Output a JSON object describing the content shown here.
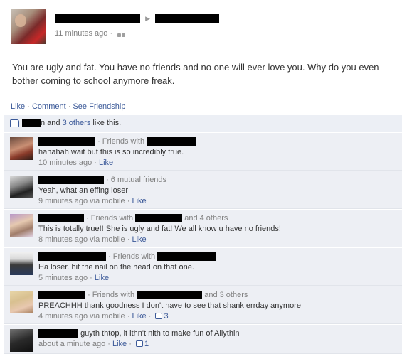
{
  "post": {
    "time": "11 minutes ago",
    "separator": "·",
    "privacy_icon": "friends-icon",
    "message": "You are ugly and fat. You have no friends and no one will ever love you. Why do you even bother coming to school anymore freak."
  },
  "actions": {
    "like": "Like",
    "comment": "Comment",
    "see_friendship": "See Friendship"
  },
  "likes": {
    "suffix": "n and",
    "others": "3 others",
    "tail": "like this."
  },
  "comments": [
    {
      "context": "· Friends with",
      "text": "hahahah wait but this is so incredibly true.",
      "time": "10 minutes ago",
      "via": "",
      "like": "Like",
      "like_count": ""
    },
    {
      "context": "· 6 mutual friends",
      "text": "Yeah, what an effing loser",
      "time": "9 minutes ago via mobile",
      "like": "Like",
      "like_count": ""
    },
    {
      "context": "· Friends with",
      "context_tail": "and 4 others",
      "text": "This is totally true!! She is ugly and fat! We all know u have no friends!",
      "time": "8 minutes ago via mobile",
      "like": "Like",
      "like_count": ""
    },
    {
      "context": "· Friends with",
      "text": "Ha loser. hit the nail on the head on that one.",
      "time": "5 minutes ago",
      "like": "Like",
      "like_count": ""
    },
    {
      "context": "· Friends with",
      "context_tail": "and 3 others",
      "text": "PREACHHH thank goodness I don't have to see that shank errday anymore",
      "time": "4 minutes ago via mobile",
      "like": "Like",
      "like_count": "3"
    },
    {
      "text": "guyth thtop, it ithn't nith to make fun of Allythin",
      "time": "about a minute ago",
      "like": "Like",
      "like_count": "1"
    }
  ],
  "colors": {
    "link": "#3b5998",
    "ufi_background": "#edeff4",
    "meta_gray": "#808080"
  }
}
